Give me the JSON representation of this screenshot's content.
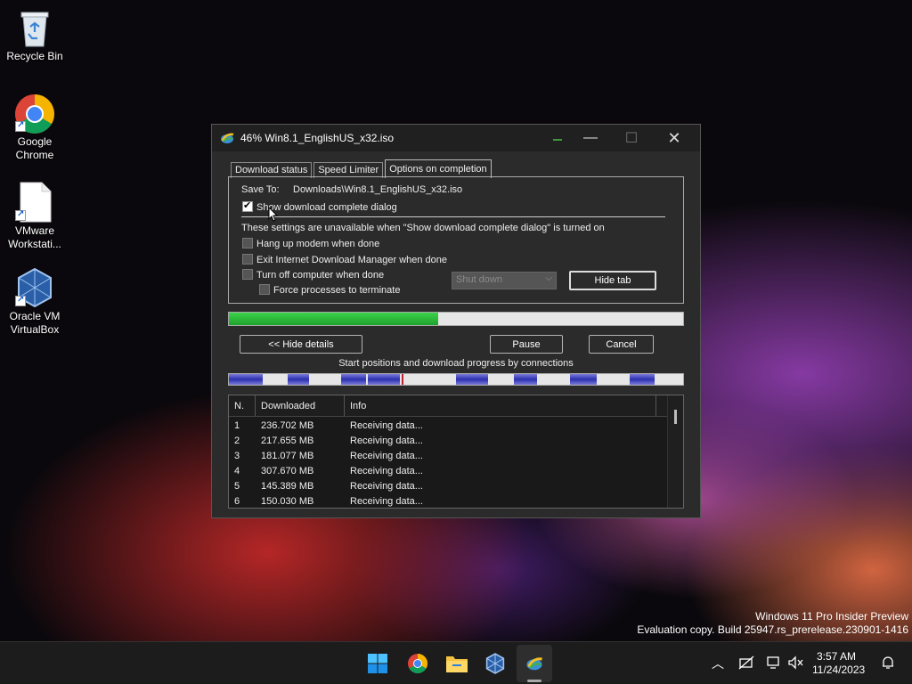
{
  "desktop": {
    "icons": [
      {
        "label": "Recycle Bin"
      },
      {
        "label": "Google Chrome"
      },
      {
        "label": "VMware Workstati..."
      },
      {
        "label": "Oracle VM VirtualBox"
      }
    ],
    "watermark": {
      "line1": "Windows 11 Pro Insider Preview",
      "line2": "Evaluation copy. Build 25947.rs_prerelease.230901-1416"
    }
  },
  "window": {
    "title": "46% Win8.1_EnglishUS_x32.iso",
    "controls": {
      "minimize": "—",
      "maximize": "☐",
      "close": "✕"
    },
    "tabs": [
      {
        "label": "Download status",
        "active": false
      },
      {
        "label": "Speed Limiter",
        "active": false
      },
      {
        "label": "Options on completion",
        "active": true
      }
    ],
    "options": {
      "save_to_label": "Save To:",
      "save_to_value": "Downloads\\Win8.1_EnglishUS_x32.iso",
      "show_dialog_label": "Show download complete dialog",
      "show_dialog_checked": true,
      "unavailable_note": "These settings are unavailable when \"Show download complete dialog\" is turned on",
      "hang_up_label": "Hang up modem when done",
      "exit_idm_label": "Exit Internet Download Manager when done",
      "turn_off_label": "Turn off computer when done",
      "force_label": "Force processes to terminate",
      "shutdown_select": "Shut down",
      "hide_tab_button": "Hide tab"
    },
    "progress_percent": 46,
    "buttons": {
      "hide_details": "<< Hide details",
      "pause": "Pause",
      "cancel": "Cancel"
    },
    "connections_label": "Start positions and download progress by connections",
    "table": {
      "headers": {
        "n": "N.",
        "downloaded": "Downloaded",
        "info": "Info"
      },
      "rows": [
        {
          "n": "1",
          "downloaded": "236.702  MB",
          "info": "Receiving data..."
        },
        {
          "n": "2",
          "downloaded": "217.655  MB",
          "info": "Receiving data..."
        },
        {
          "n": "3",
          "downloaded": "181.077  MB",
          "info": "Receiving data..."
        },
        {
          "n": "4",
          "downloaded": "307.670  MB",
          "info": "Receiving data..."
        },
        {
          "n": "5",
          "downloaded": "145.389  MB",
          "info": "Receiving data..."
        },
        {
          "n": "6",
          "downloaded": "150.030  MB",
          "info": "Receiving data..."
        }
      ]
    }
  },
  "taskbar": {
    "apps": [
      "start-icon",
      "chrome-icon",
      "file-explorer-icon",
      "virtualbox-icon",
      "idm-icon"
    ],
    "clock": {
      "time": "3:57 AM",
      "date": "11/24/2023"
    }
  },
  "colors": {
    "progress": "#1ea22d",
    "connection_segment": "#2b2fb0"
  }
}
